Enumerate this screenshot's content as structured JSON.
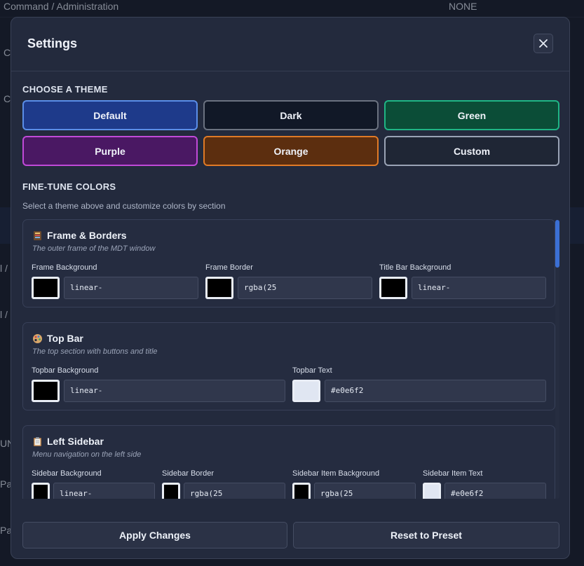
{
  "background": {
    "header_left": "Command / Administration",
    "header_right": "NONE",
    "left_fragments": [
      "C",
      "C",
      "l /",
      "l /",
      "UN",
      "Pat",
      "Pat"
    ]
  },
  "modal": {
    "title": "Settings",
    "close_glyph": "✕"
  },
  "themes": {
    "heading": "CHOOSE A THEME",
    "items": [
      {
        "label": "Default",
        "bg": "#1e3a8a",
        "border": "#5b8ee8"
      },
      {
        "label": "Dark",
        "bg": "#111827",
        "border": "#6b7280"
      },
      {
        "label": "Green",
        "bg": "#0b4d37",
        "border": "#1fb585"
      },
      {
        "label": "Purple",
        "bg": "#4a1863",
        "border": "#c04ad8"
      },
      {
        "label": "Orange",
        "bg": "#5c2e0f",
        "border": "#e07a26"
      },
      {
        "label": "Custom",
        "bg": "#1f2635",
        "border": "#9aa3b5"
      }
    ]
  },
  "fine_tune": {
    "heading": "FINE-TUNE COLORS",
    "hint": "Select a theme above and customize colors by section"
  },
  "sections": [
    {
      "title": "Frame & Borders",
      "description": "The outer frame of the MDT window",
      "icon": "frame-icon",
      "fields": [
        {
          "label": "Frame Background",
          "value": "linear-",
          "swatch": "#000000"
        },
        {
          "label": "Frame Border",
          "value": "rgba(25",
          "swatch": "#000000"
        },
        {
          "label": "Title Bar Background",
          "value": "linear-",
          "swatch": "#000000"
        }
      ]
    },
    {
      "title": "Top Bar",
      "description": "The top section with buttons and title",
      "icon": "palette-icon",
      "fields": [
        {
          "label": "Topbar Background",
          "value": "linear-",
          "swatch": "#000000"
        },
        {
          "label": "Topbar Text",
          "value": "#e0e6f2",
          "swatch": "#e0e6f2"
        }
      ]
    },
    {
      "title": "Left Sidebar",
      "description": "Menu navigation on the left side",
      "icon": "clipboard-icon",
      "fields": [
        {
          "label": "Sidebar Background",
          "value": "linear-",
          "swatch": "#000000"
        },
        {
          "label": "Sidebar Border",
          "value": "rgba(25",
          "swatch": "#000000"
        },
        {
          "label": "Sidebar Item Background",
          "value": "rgba(25",
          "swatch": "#000000"
        },
        {
          "label": "Sidebar Item Text",
          "value": "#e0e6f2",
          "swatch": "#e0e6f2"
        }
      ]
    }
  ],
  "footer": {
    "apply_label": "Apply Changes",
    "reset_label": "Reset to Preset"
  }
}
